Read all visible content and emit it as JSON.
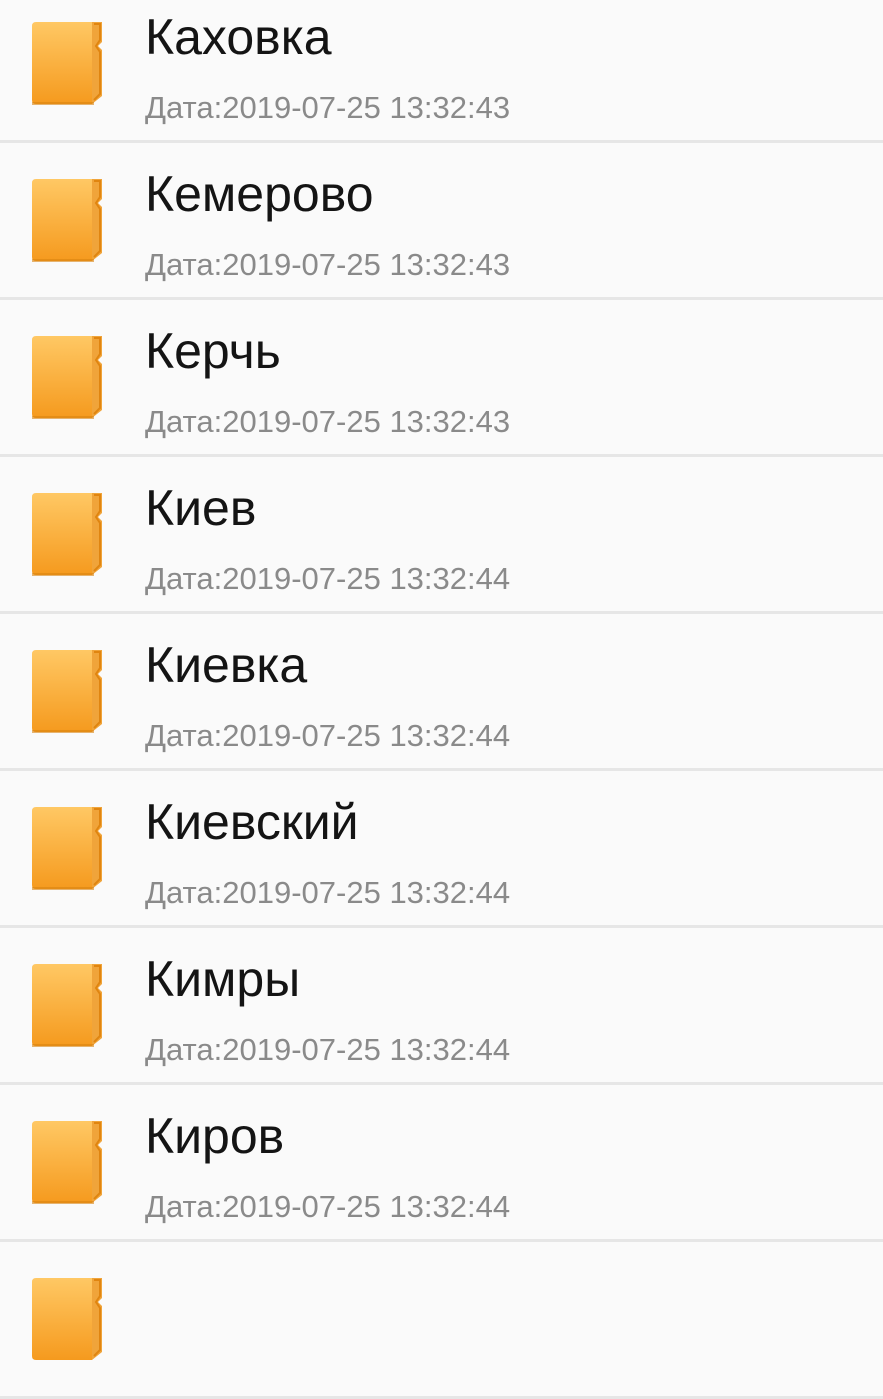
{
  "folders": [
    {
      "name": "Каховка",
      "date": "Дата:2019-07-25 13:32:43",
      "icon": "folder-icon"
    },
    {
      "name": "Кемерово",
      "date": "Дата:2019-07-25 13:32:43",
      "icon": "folder-icon"
    },
    {
      "name": "Керчь",
      "date": "Дата:2019-07-25 13:32:43",
      "icon": "folder-icon"
    },
    {
      "name": "Киев",
      "date": "Дата:2019-07-25 13:32:44",
      "icon": "folder-icon"
    },
    {
      "name": "Киевка",
      "date": "Дата:2019-07-25 13:32:44",
      "icon": "folder-icon"
    },
    {
      "name": "Киевский",
      "date": "Дата:2019-07-25 13:32:44",
      "icon": "folder-icon"
    },
    {
      "name": "Кимры",
      "date": "Дата:2019-07-25 13:32:44",
      "icon": "folder-icon"
    },
    {
      "name": "Киров",
      "date": "Дата:2019-07-25 13:32:44",
      "icon": "folder-icon"
    }
  ],
  "colors": {
    "folder_light": "#ffc25a",
    "folder_dark": "#f59a1e",
    "folder_edge": "#e08510",
    "separator": "#e6e6e6",
    "background": "#fafafa"
  }
}
